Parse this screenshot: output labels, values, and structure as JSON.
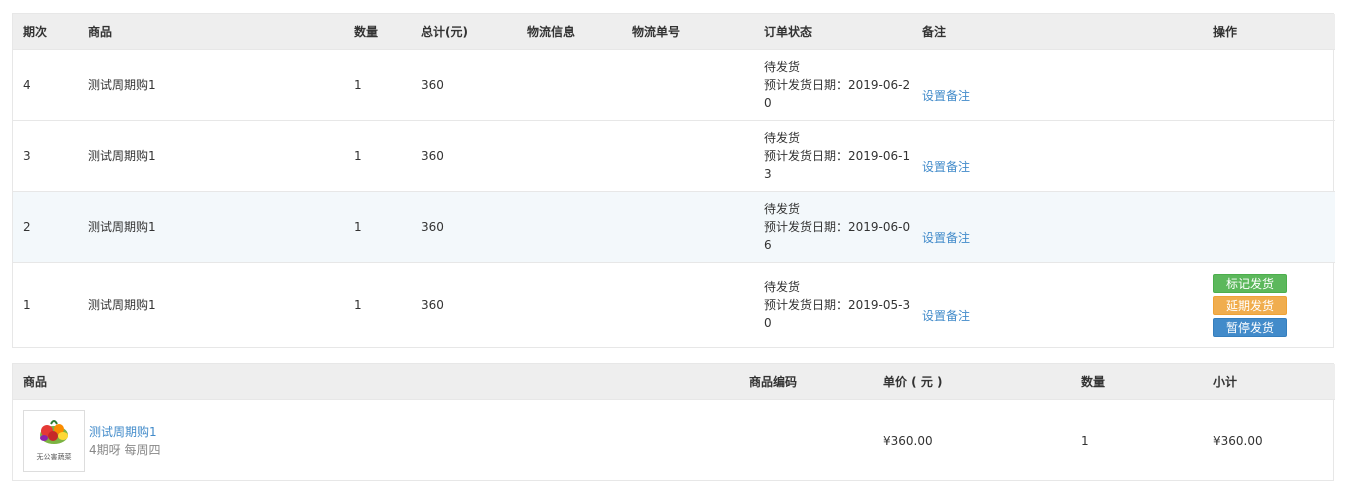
{
  "orders": {
    "headers": {
      "period": "期次",
      "product": "商品",
      "qty": "数量",
      "total": "总计(元)",
      "logistics": "物流信息",
      "tracking": "物流单号",
      "status": "订单状态",
      "remark": "备注",
      "actions": "操作"
    },
    "rows": [
      {
        "period": "4",
        "product": "测试周期购1",
        "qty": "1",
        "total": "360",
        "logistics": "",
        "tracking": "",
        "status": "待发货",
        "date_line": "预计发货日期：2019-06-20",
        "remark_link": "设置备注"
      },
      {
        "period": "3",
        "product": "测试周期购1",
        "qty": "1",
        "total": "360",
        "logistics": "",
        "tracking": "",
        "status": "待发货",
        "date_line": "预计发货日期：2019-06-13",
        "remark_link": "设置备注"
      },
      {
        "period": "2",
        "product": "测试周期购1",
        "qty": "1",
        "total": "360",
        "logistics": "",
        "tracking": "",
        "status": "待发货",
        "date_line": "预计发货日期：2019-06-06",
        "remark_link": "设置备注"
      },
      {
        "period": "1",
        "product": "测试周期购1",
        "qty": "1",
        "total": "360",
        "logistics": "",
        "tracking": "",
        "status": "待发货",
        "date_line": "预计发货日期：2019-05-30",
        "remark_link": "设置备注"
      }
    ],
    "action_buttons": {
      "mark_shipped": "标记发货",
      "delay_shipping": "延期发货",
      "pause_shipping": "暂停发货"
    }
  },
  "goods": {
    "headers": {
      "product": "商品",
      "code": "商品编码",
      "unit_price": "单价 ( 元 )",
      "qty": "数量",
      "subtotal": "小计"
    },
    "item": {
      "thumb_caption": "无公害蔬菜",
      "name": "测试周期购1",
      "spec": "4期呀 每周四",
      "code": "",
      "unit_price": "¥360.00",
      "qty": "1",
      "subtotal": "¥360.00"
    }
  },
  "colors": {
    "link": "#428bca",
    "header_bg": "#eeeeee",
    "highlight_row": "#f3f8fb",
    "btn_green": "#5cb85c",
    "btn_orange": "#f0ad4e",
    "btn_blue": "#428bca"
  }
}
